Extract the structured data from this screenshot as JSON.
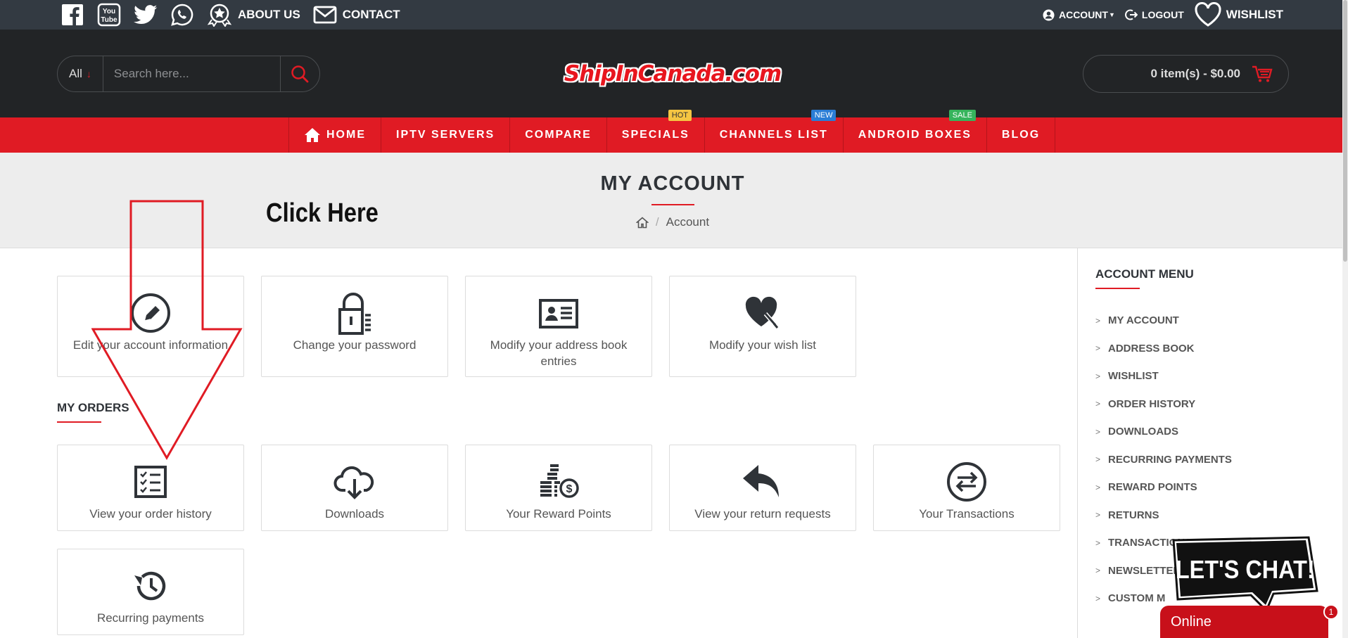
{
  "topbar": {
    "social": [
      "facebook-icon",
      "youtube-icon",
      "twitter-icon",
      "whatsapp-icon"
    ],
    "about_label": "ABOUT US",
    "contact_label": "CONTACT",
    "account_label": "ACCOUNT",
    "logout_label": "LOGOUT",
    "wishlist_label": "WISHLIST"
  },
  "header": {
    "search_category": "All",
    "search_placeholder": "Search here...",
    "logo_text": "ShipInCanada.com",
    "cart_label": "0 item(s) - $0.00"
  },
  "nav": {
    "items": [
      {
        "label": "HOME",
        "badge": ""
      },
      {
        "label": "IPTV SERVERS",
        "badge": ""
      },
      {
        "label": "COMPARE",
        "badge": ""
      },
      {
        "label": "SPECIALS",
        "badge": "HOT"
      },
      {
        "label": "CHANNELS LIST",
        "badge": "NEW"
      },
      {
        "label": "ANDROID BOXES",
        "badge": "SALE"
      },
      {
        "label": "BLOG",
        "badge": ""
      }
    ]
  },
  "page": {
    "title": "MY ACCOUNT",
    "breadcrumb_current": "Account",
    "annotation": "Click Here"
  },
  "account_tiles": [
    {
      "label": "Edit your account information",
      "icon": "pencil-icon"
    },
    {
      "label": "Change your password",
      "icon": "lock-icon"
    },
    {
      "label": "Modify your address book entries",
      "icon": "address-card-icon"
    },
    {
      "label": "Modify your wish list",
      "icon": "heart-edit-icon"
    }
  ],
  "orders": {
    "title": "MY ORDERS",
    "tiles": [
      {
        "label": "View your order history",
        "icon": "checklist-icon"
      },
      {
        "label": "Downloads",
        "icon": "cloud-download-icon"
      },
      {
        "label": "Your Reward Points",
        "icon": "coins-icon"
      },
      {
        "label": "View your return requests",
        "icon": "reply-icon"
      },
      {
        "label": "Your Transactions",
        "icon": "exchange-icon"
      },
      {
        "label": "Recurring payments",
        "icon": "history-icon"
      }
    ]
  },
  "sidebar": {
    "title": "ACCOUNT MENU",
    "items": [
      "MY ACCOUNT",
      "ADDRESS BOOK",
      "WISHLIST",
      "ORDER HISTORY",
      "DOWNLOADS",
      "RECURRING PAYMENTS",
      "REWARD POINTS",
      "RETURNS",
      "TRANSACTIONS",
      "NEWSLETTER",
      "CUSTOM M"
    ]
  },
  "chat": {
    "bubble_text": "LET'S CHAT!",
    "status": "Online",
    "unread": "1"
  },
  "colors": {
    "accent": "#e01b24",
    "topbar": "#333a42",
    "header": "#222426"
  }
}
